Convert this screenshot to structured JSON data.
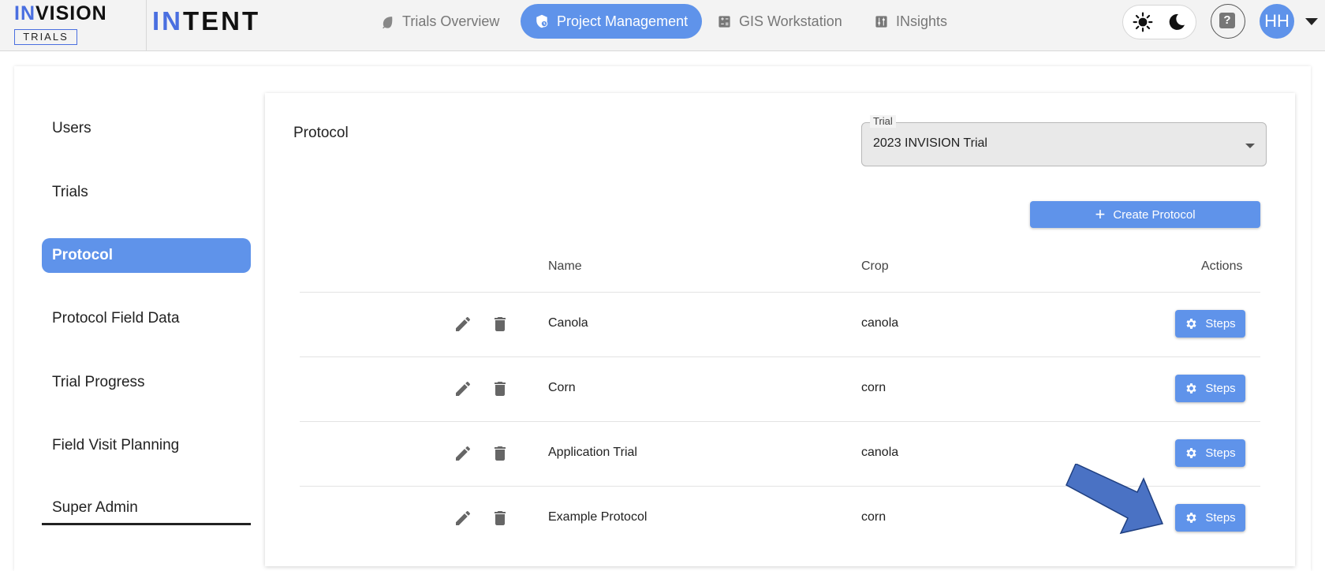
{
  "brand": {
    "main_prefix": "IN",
    "main_rest": "VISION",
    "sub": "TRIALS",
    "second_prefix": "IN",
    "second_rest": "TENT"
  },
  "nav": {
    "trials_overview": "Trials Overview",
    "project_management": "Project Management",
    "gis_workstation": "GIS Workstation",
    "insights": "INsights"
  },
  "user": {
    "initials": "HH"
  },
  "help": {
    "label": "?"
  },
  "sidebar": {
    "items": [
      "Users",
      "Trials",
      "Protocol",
      "Protocol Field Data",
      "Trial Progress",
      "Field Visit Planning",
      "Super Admin"
    ],
    "active": "Protocol"
  },
  "content": {
    "title": "Protocol",
    "trial_select": {
      "label": "Trial",
      "value": "2023 INVISION Trial"
    },
    "create_button": "Create Protocol",
    "table": {
      "headers": {
        "name": "Name",
        "crop": "Crop",
        "actions": "Actions"
      },
      "rows": [
        {
          "name": "Canola",
          "crop": "canola",
          "action": "Steps"
        },
        {
          "name": "Corn",
          "crop": "corn",
          "action": "Steps"
        },
        {
          "name": "Application Trial",
          "crop": "canola",
          "action": "Steps"
        },
        {
          "name": "Example Protocol",
          "crop": "corn",
          "action": "Steps"
        }
      ]
    }
  },
  "colors": {
    "accent": "#5f93ea",
    "brand_blue": "#4a6fe0",
    "annotation_arrow": "#4a72c4"
  },
  "icons": {
    "trials_overview": "leaf-icon",
    "project_management": "shield-clock-icon",
    "gis_workstation": "calculator-icon",
    "insights": "sliders-icon",
    "light_mode": "sun-icon",
    "dark_mode": "moon-icon",
    "help": "help-icon",
    "edit": "pencil-icon",
    "delete": "trash-icon",
    "steps": "gear-icon",
    "create": "plus-icon"
  }
}
